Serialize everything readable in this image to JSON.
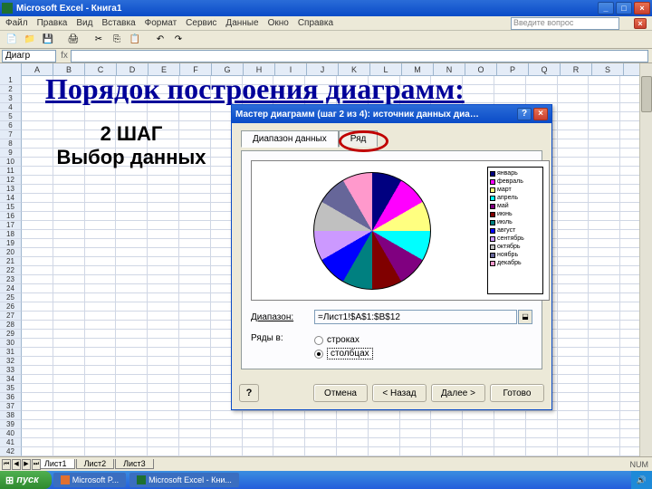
{
  "window": {
    "title": "Microsoft Excel - Книга1",
    "ask": "Введите вопрос"
  },
  "menu": {
    "m1": "Файл",
    "m2": "Правка",
    "m3": "Вид",
    "m4": "Вставка",
    "m5": "Формат",
    "m6": "Сервис",
    "m7": "Данные",
    "m8": "Окно",
    "m9": "Справка"
  },
  "formula": {
    "cell": "Диагр",
    "fx": "fx"
  },
  "columns": {
    "A": "A",
    "B": "B",
    "C": "C",
    "D": "D",
    "E": "E",
    "F": "F",
    "G": "G",
    "H": "H",
    "I": "I",
    "J": "J",
    "K": "K",
    "L": "L",
    "M": "M",
    "N": "N",
    "O": "O",
    "P": "P",
    "Q": "Q",
    "R": "R",
    "S": "S"
  },
  "heading": "Порядок построения диаграмм:",
  "step": {
    "line1": "2 ШАГ",
    "line2": "Выбор данных"
  },
  "dialog": {
    "title": "Мастер диаграмм (шаг 2 из 4): источник данных диа…",
    "tab1": "Диапазон данных",
    "tab2": "Ряд",
    "range_label": "Диапазон:",
    "range_value": "=Лист1!$A$1:$B$12",
    "rows_label": "Ряды в:",
    "opt_rows": "строках",
    "opt_cols": "столбцах",
    "btn_help": "?",
    "btn_cancel": "Отмена",
    "btn_back": "< Назад",
    "btn_next": "Далее >",
    "btn_finish": "Готово"
  },
  "legend": {
    "i1": "январь",
    "i2": "февраль",
    "i3": "март",
    "i4": "апрель",
    "i5": "май",
    "i6": "июнь",
    "i7": "июль",
    "i8": "август",
    "i9": "сентябрь",
    "i10": "октябрь",
    "i11": "ноябрь",
    "i12": "декабрь"
  },
  "legend_colors": {
    "c1": "#000080",
    "c2": "#ff00ff",
    "c3": "#ffff80",
    "c4": "#00ffff",
    "c5": "#800080",
    "c6": "#800000",
    "c7": "#008080",
    "c8": "#0000ff",
    "c9": "#cc99ff",
    "c10": "#c0c0c0",
    "c11": "#666699",
    "c12": "#ff99cc"
  },
  "sheets": {
    "s1": "Лист1",
    "s2": "Лист2",
    "s3": "Лист3"
  },
  "taskbar": {
    "start": "пуск",
    "t1": "Microsoft P...",
    "t2": "Microsoft Excel - Кни..."
  },
  "status": "NUM",
  "chart_data": {
    "type": "pie",
    "title": "",
    "categories": [
      "январь",
      "февраль",
      "март",
      "апрель",
      "май",
      "июнь",
      "июль",
      "август",
      "сентябрь",
      "октябрь",
      "ноябрь",
      "декабрь"
    ],
    "values": [
      1,
      1,
      1,
      1,
      1,
      1,
      1,
      1,
      1,
      1,
      1,
      1
    ],
    "colors": [
      "#000080",
      "#ff00ff",
      "#ffff80",
      "#00ffff",
      "#800080",
      "#800000",
      "#008080",
      "#0000ff",
      "#cc99ff",
      "#c0c0c0",
      "#666699",
      "#ff99cc"
    ]
  }
}
